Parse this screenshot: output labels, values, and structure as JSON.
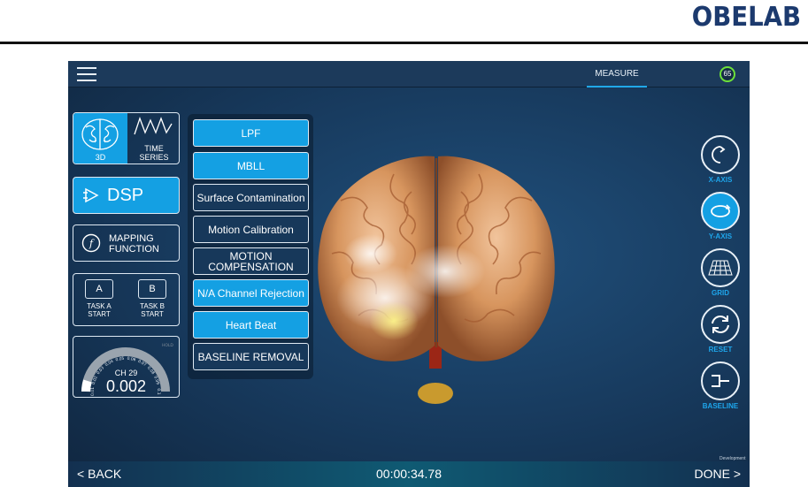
{
  "header": {
    "logo": "OBELAB"
  },
  "topbar": {
    "measure_tab": "MEASURE",
    "battery": "65"
  },
  "left_panel": {
    "view_3d": "3D",
    "view_time_series": "TIME\nSERIES",
    "dsp": "DSP",
    "mapping_function": "MAPPING\nFUNCTION",
    "task_a": {
      "box": "A",
      "label": "TASK A\nSTART"
    },
    "task_b": {
      "box": "B",
      "label": "TASK B\nSTART"
    },
    "gauge": {
      "channel": "CH 29",
      "value": "0.002",
      "ticks": [
        "0.01",
        "0.02",
        "0.03",
        "0.04",
        "0.05",
        "0.06",
        "0.07",
        "0.08",
        "0.09",
        "0.1"
      ],
      "hold": "HOLD"
    }
  },
  "dsp_options": [
    {
      "label": "LPF",
      "active": true
    },
    {
      "label": "MBLL",
      "active": true
    },
    {
      "label": "Surface Contamination",
      "active": false
    },
    {
      "label": "Motion Calibration",
      "active": false
    },
    {
      "label": "MOTION\nCOMPENSATION",
      "active": false
    },
    {
      "label": "N/A Channel Rejection",
      "active": true
    },
    {
      "label": "Heart Beat",
      "active": true
    },
    {
      "label": "BASELINE REMOVAL",
      "active": false
    }
  ],
  "tools": [
    {
      "label": "X-AXIS",
      "icon": "x-axis-rotate-icon",
      "active": false
    },
    {
      "label": "Y-AXIS",
      "icon": "y-axis-rotate-icon",
      "active": true
    },
    {
      "label": "GRID",
      "icon": "grid-icon",
      "active": false
    },
    {
      "label": "RESET",
      "icon": "reset-icon",
      "active": false
    },
    {
      "label": "BASELINE",
      "icon": "baseline-icon",
      "active": false
    }
  ],
  "dev_tag": "Development Build",
  "bottombar": {
    "back": "< BACK",
    "timer": "00:00:34.78",
    "done": "DONE >"
  },
  "colors": {
    "accent": "#14a0e3",
    "background": "#17395c",
    "tool_label": "#1ea6ec",
    "battery": "#6ce03a"
  }
}
